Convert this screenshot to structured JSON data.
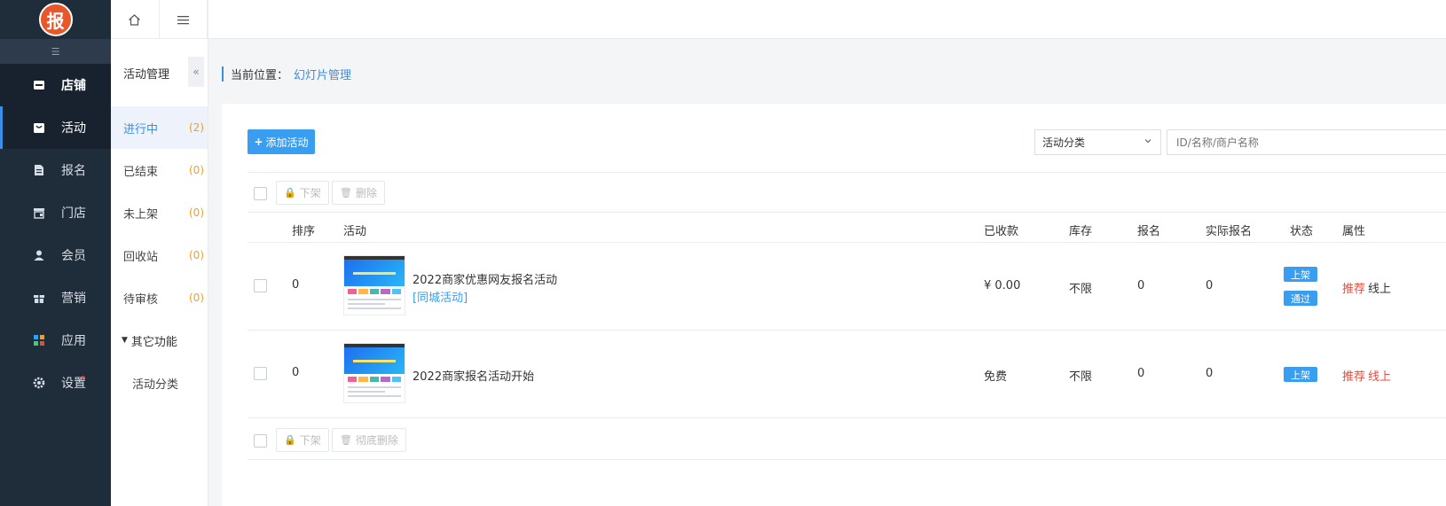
{
  "logo": {
    "text": "报"
  },
  "sidebar": {
    "items": [
      {
        "label": "店铺",
        "icon": "store-icon"
      },
      {
        "label": "活动",
        "icon": "bag-icon"
      },
      {
        "label": "报名",
        "icon": "document-icon"
      },
      {
        "label": "门店",
        "icon": "shop-icon"
      },
      {
        "label": "会员",
        "icon": "user-icon"
      },
      {
        "label": "营销",
        "icon": "gift-icon"
      },
      {
        "label": "应用",
        "icon": "apps-icon"
      },
      {
        "label": "设置",
        "icon": "gear-icon"
      }
    ]
  },
  "subnav": {
    "title": "活动管理",
    "items": [
      {
        "label": "进行中",
        "count": "(2)"
      },
      {
        "label": "已结束",
        "count": "(0)"
      },
      {
        "label": "未上架",
        "count": "(0)"
      },
      {
        "label": "回收站",
        "count": "(0)"
      },
      {
        "label": "待审核",
        "count": "(0)"
      }
    ],
    "group": "其它功能",
    "group_child": "活动分类"
  },
  "breadcrumb": {
    "prefix": "当前位置：",
    "current": "幻灯片管理"
  },
  "toolbar": {
    "add_label": "添加活动",
    "category_select": "活动分类",
    "search_placeholder": "ID/名称/商户名称",
    "offline_label": "下架",
    "delete_label": "删除",
    "purge_label": "彻底删除"
  },
  "table": {
    "headers": [
      "排序",
      "活动",
      "已收款",
      "库存",
      "报名",
      "实际报名",
      "状态",
      "属性"
    ],
    "rows": [
      {
        "sort": "0",
        "title": "2022商家优惠网友报名活动",
        "tag": "[同城活动]",
        "received": "¥ 0.00",
        "stock": "不限",
        "signup": "0",
        "actual": "0",
        "status": [
          "上架",
          "通过"
        ],
        "attr_red": "推荐",
        "attr_other": "线上"
      },
      {
        "sort": "0",
        "title": "2022商家报名活动开始",
        "tag": "",
        "received": "免费",
        "stock": "不限",
        "signup": "0",
        "actual": "0",
        "status": [
          "上架"
        ],
        "attr_red": "推荐",
        "attr_other": "线上"
      }
    ]
  },
  "colors": {
    "accent": "#3a9ef0",
    "sidebar": "#1f2c3a",
    "warn": "#f0a020",
    "danger": "#e84b3c"
  }
}
